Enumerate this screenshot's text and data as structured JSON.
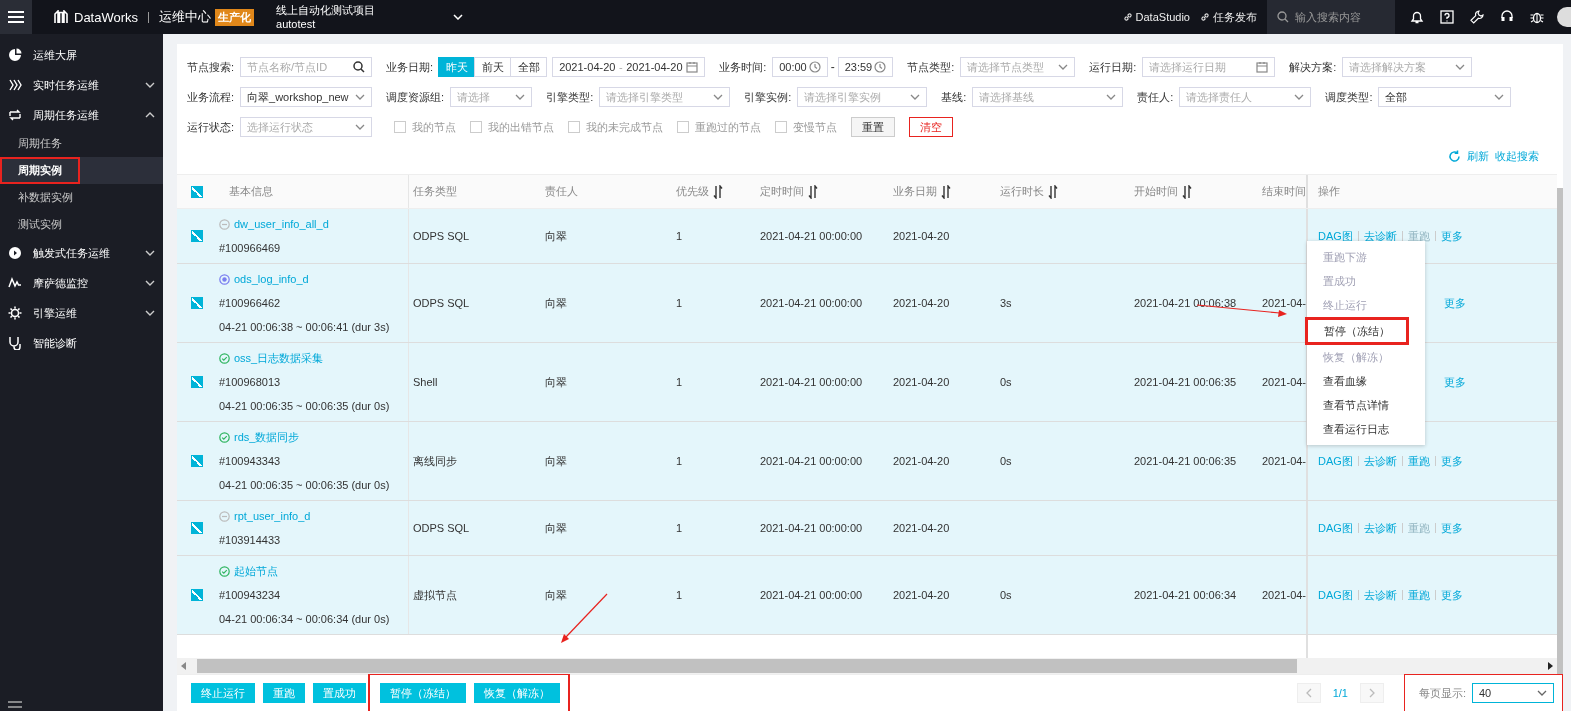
{
  "topbar": {
    "app_name": "DataWorks",
    "section": "运维中心",
    "env_badge": "生产化",
    "project": {
      "name": "线上自动化测试项目",
      "id": "autotest"
    },
    "links": [
      {
        "label": "DataStudio"
      },
      {
        "label": "任务发布"
      }
    ],
    "search": {
      "placeholder": "输入搜索内容"
    }
  },
  "sidebar": {
    "items": [
      {
        "kind": "dashboard",
        "label": "运维大屏"
      },
      {
        "kind": "realtime",
        "label": "实时任务运维",
        "expanded": false
      },
      {
        "kind": "cycle",
        "label": "周期任务运维",
        "expanded": true,
        "children": [
          {
            "label": "周期任务",
            "selected": false,
            "highlighted": false
          },
          {
            "label": "周期实例",
            "selected": true,
            "highlighted": true
          },
          {
            "label": "补数据实例",
            "selected": false,
            "highlighted": false
          },
          {
            "label": "测试实例",
            "selected": false,
            "highlighted": false
          }
        ]
      },
      {
        "kind": "trigger",
        "label": "触发式任务运维",
        "expanded": false
      },
      {
        "kind": "monitor",
        "label": "摩萨德监控",
        "expanded": false
      },
      {
        "kind": "engine",
        "label": "引擎运维",
        "expanded": false
      },
      {
        "kind": "diagnose",
        "label": "智能诊断"
      }
    ]
  },
  "filters": {
    "rows": [
      {
        "fields": [
          {
            "kind": "search",
            "label": "节点搜索:",
            "placeholder": "节点名称/节点ID"
          },
          {
            "kind": "segmented",
            "label": "业务日期:",
            "options": [
              {
                "label": "昨天",
                "selected": true
              },
              {
                "label": "前天",
                "selected": false
              },
              {
                "label": "全部",
                "selected": false
              }
            ]
          },
          {
            "kind": "daterange",
            "start": "2021-04-20",
            "separator": "-",
            "end": "2021-04-20"
          },
          {
            "kind": "timerange",
            "label": "业务时间:",
            "start": "00:00",
            "separator": "-",
            "end": "23:59"
          },
          {
            "kind": "select",
            "label": "节点类型:",
            "placeholder": "请选择节点类型"
          },
          {
            "kind": "date",
            "label": "运行日期:",
            "placeholder": "请选择运行日期"
          },
          {
            "kind": "select",
            "label": "解决方案:",
            "placeholder": "请选择解决方案"
          }
        ]
      },
      {
        "fields": [
          {
            "kind": "select",
            "label": "业务流程:",
            "value": "向翠_workshop_new"
          },
          {
            "kind": "select",
            "label": "调度资源组:",
            "placeholder": "请选择"
          },
          {
            "kind": "select",
            "label": "引擎类型:",
            "placeholder": "请选择引擎类型"
          },
          {
            "kind": "select",
            "label": "引擎实例:",
            "placeholder": "请选择引擎实例"
          },
          {
            "kind": "select",
            "label": "基线:",
            "placeholder": "请选择基线"
          },
          {
            "kind": "select",
            "label": "责任人:",
            "placeholder": "请选择责任人"
          },
          {
            "kind": "select",
            "label": "调度类型:",
            "value": "全部"
          }
        ]
      },
      {
        "fields": [
          {
            "kind": "select",
            "label": "运行状态:",
            "placeholder": "选择运行状态"
          },
          {
            "kind": "checkbox",
            "label": "我的节点",
            "checked": false
          },
          {
            "kind": "checkbox",
            "label": "我的出错节点",
            "checked": false
          },
          {
            "kind": "checkbox",
            "label": "我的未完成节点",
            "checked": false
          },
          {
            "kind": "checkbox",
            "label": "重跑过的节点",
            "checked": false
          },
          {
            "kind": "checkbox",
            "label": "变慢节点",
            "checked": false
          },
          {
            "kind": "button",
            "label": "重置"
          },
          {
            "kind": "danger-button",
            "label": "清空"
          }
        ]
      }
    ],
    "refresh": "刷新",
    "collapse": "收起搜索"
  },
  "table": {
    "select_all": true,
    "columns": [
      {
        "label": "基本信息",
        "sortable": false
      },
      {
        "label": "任务类型",
        "sortable": false
      },
      {
        "label": "责任人",
        "sortable": false
      },
      {
        "label": "优先级",
        "sortable": true
      },
      {
        "label": "定时时间",
        "sortable": true
      },
      {
        "label": "业务日期",
        "sortable": true
      },
      {
        "label": "运行时长",
        "sortable": true
      },
      {
        "label": "开始时间",
        "sortable": true
      },
      {
        "label": "结束时间"
      },
      {
        "label": "操作",
        "sortable": false
      }
    ],
    "rows": [
      {
        "checked": true,
        "kind": "paused",
        "name": "dw_user_info_all_d",
        "id": "#100966469",
        "task_type": "ODPS SQL",
        "owner": "向翠",
        "priority": "1",
        "scheduled_time": "2021-04-21 00:00:00",
        "biz_date": "2021-04-20",
        "actions": [
          {
            "label": "DAG图",
            "disabled": false
          },
          {
            "label": "去诊断",
            "disabled": false
          },
          {
            "label": "重跑",
            "disabled": true
          },
          {
            "label": "更多",
            "disabled": false
          }
        ]
      },
      {
        "checked": true,
        "kind": "running",
        "name": "ods_log_info_d",
        "id": "#100966462",
        "run_window": "04-21 00:06:38 ~ 00:06:41 (dur 3s)",
        "task_type": "ODPS SQL",
        "owner": "向翠",
        "priority": "1",
        "scheduled_time": "2021-04-21 00:00:00",
        "biz_date": "2021-04-20",
        "duration": "3s",
        "start_time": "2021-04-21 00:06:38",
        "end_time": "2021-04-",
        "actions": [
          {
            "label": "更多",
            "disabled": false
          }
        ]
      },
      {
        "checked": true,
        "kind": "success",
        "name": "oss_日志数据采集",
        "id": "#100968013",
        "run_window": "04-21 00:06:35 ~ 00:06:35 (dur 0s)",
        "task_type": "Shell",
        "owner": "向翠",
        "priority": "1",
        "scheduled_time": "2021-04-21 00:00:00",
        "biz_date": "2021-04-20",
        "duration": "0s",
        "start_time": "2021-04-21 00:06:35",
        "end_time": "2021-04-",
        "actions": [
          {
            "label": "更多",
            "disabled": false
          }
        ]
      },
      {
        "checked": true,
        "kind": "success",
        "name": "rds_数据同步",
        "id": "#100943343",
        "run_window": "04-21 00:06:35 ~ 00:06:35 (dur 0s)",
        "task_type": "离线同步",
        "owner": "向翠",
        "priority": "1",
        "scheduled_time": "2021-04-21 00:00:00",
        "biz_date": "2021-04-20",
        "duration": "0s",
        "start_time": "2021-04-21 00:06:35",
        "end_time": "2021-04-",
        "actions": [
          {
            "label": "DAG图",
            "disabled": false
          },
          {
            "label": "去诊断",
            "disabled": false
          },
          {
            "label": "重跑",
            "disabled": false
          },
          {
            "label": "更多",
            "disabled": false
          }
        ]
      },
      {
        "checked": true,
        "kind": "paused",
        "name": "rpt_user_info_d",
        "id": "#103914433",
        "task_type": "ODPS SQL",
        "owner": "向翠",
        "priority": "1",
        "scheduled_time": "2021-04-21 00:00:00",
        "biz_date": "2021-04-20",
        "actions": [
          {
            "label": "DAG图",
            "disabled": false
          },
          {
            "label": "去诊断",
            "disabled": false
          },
          {
            "label": "重跑",
            "disabled": true
          },
          {
            "label": "更多",
            "disabled": false
          }
        ]
      },
      {
        "checked": true,
        "kind": "success",
        "name": "起始节点",
        "id": "#100943234",
        "run_window": "04-21 00:06:34 ~ 00:06:34 (dur 0s)",
        "task_type": "虚拟节点",
        "owner": "向翠",
        "priority": "1",
        "scheduled_time": "2021-04-21 00:00:00",
        "biz_date": "2021-04-20",
        "duration": "0s",
        "start_time": "2021-04-21 00:06:34",
        "end_time": "2021-04-",
        "actions": [
          {
            "label": "DAG图",
            "disabled": false
          },
          {
            "label": "去诊断",
            "disabled": false
          },
          {
            "label": "重跑",
            "disabled": false
          },
          {
            "label": "更多",
            "disabled": false
          }
        ]
      }
    ],
    "more_menu": {
      "items": [
        {
          "label": "重跑下游",
          "disabled": true,
          "highlighted": false
        },
        {
          "label": "置成功",
          "disabled": true,
          "highlighted": false
        },
        {
          "label": "终止运行",
          "disabled": true,
          "highlighted": false
        },
        {
          "label": "暂停（冻结）",
          "disabled": false,
          "highlighted": true
        },
        {
          "label": "恢复（解冻）",
          "disabled": true,
          "highlighted": false
        },
        {
          "label": "查看血缘",
          "disabled": false,
          "highlighted": false
        },
        {
          "label": "查看节点详情",
          "disabled": false,
          "highlighted": false
        },
        {
          "label": "查看运行日志",
          "disabled": false,
          "highlighted": false
        }
      ]
    }
  },
  "footer": {
    "bulk_actions": [
      {
        "label": "终止运行"
      },
      {
        "label": "重跑"
      },
      {
        "label": "置成功"
      }
    ],
    "freeze_actions": {
      "highlighted": true,
      "buttons": [
        {
          "label": "暂停（冻结）"
        },
        {
          "label": "恢复（解冻）"
        }
      ]
    },
    "pagination": {
      "page": "1/1",
      "page_size_label": "每页显示:",
      "page_size": "40",
      "highlighted": true
    }
  }
}
